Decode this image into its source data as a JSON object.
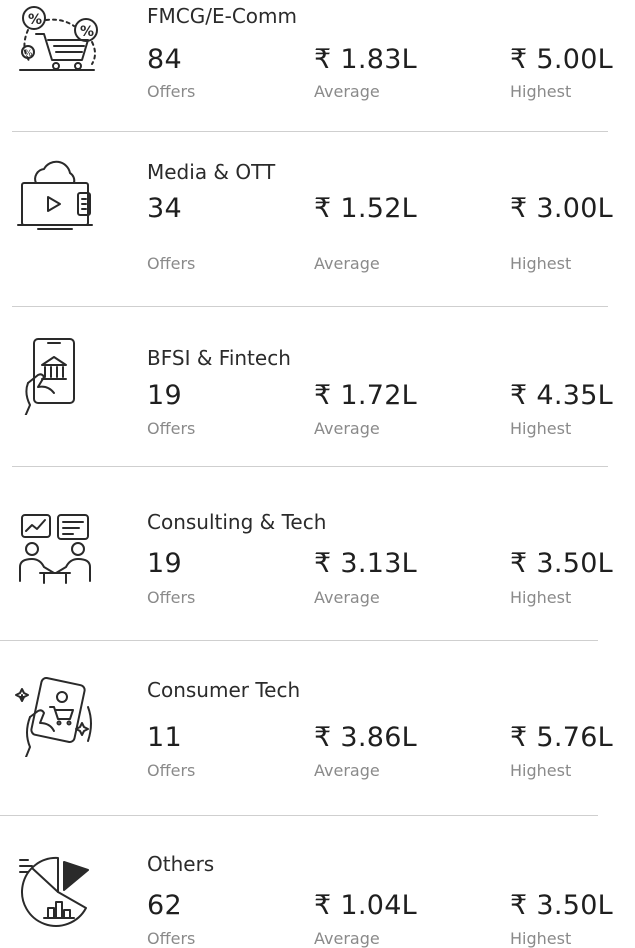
{
  "currency": "₹",
  "rows": [
    {
      "sector": "FMCG/E-Comm",
      "offers": "84",
      "offers_label": "Offers",
      "average": "₹ 1.83L",
      "average_label": "Average",
      "highest": "₹ 5.00L",
      "highest_label": "Highest",
      "icon": "shopping-cart-discount-icon"
    },
    {
      "sector": "Media & OTT",
      "offers": "34",
      "offers_label": "Offers",
      "average": "₹ 1.52L",
      "average_label": "Average",
      "highest": "₹ 3.00L",
      "highest_label": "Highest",
      "icon": "cloud-tv-play-icon"
    },
    {
      "sector": "BFSI & Fintech",
      "offers": "19",
      "offers_label": "Offers",
      "average": "₹ 1.72L",
      "average_label": "Average",
      "highest": "₹ 4.35L",
      "highest_label": "Highest",
      "icon": "mobile-bank-hand-icon"
    },
    {
      "sector": "Consulting & Tech",
      "offers": "19",
      "offers_label": "Offers",
      "average": "₹ 3.13L",
      "average_label": "Average",
      "highest": "₹ 3.50L",
      "highest_label": "Highest",
      "icon": "consulting-people-chart-icon"
    },
    {
      "sector": "Consumer Tech",
      "offers": "11",
      "offers_label": "Offers",
      "average": "₹ 3.86L",
      "average_label": "Average",
      "highest": "₹ 5.76L",
      "highest_label": "Highest",
      "icon": "mobile-shopping-cart-icon"
    },
    {
      "sector": "Others",
      "offers": "62",
      "offers_label": "Offers",
      "average": "₹ 1.04L",
      "average_label": "Average",
      "highest": "₹ 3.50L",
      "highest_label": "Highest",
      "icon": "pie-chart-icon"
    }
  ]
}
